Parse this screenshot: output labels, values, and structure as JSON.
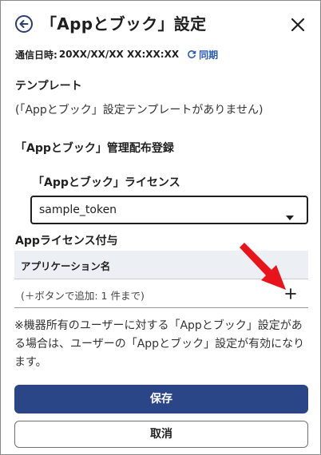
{
  "header": {
    "title": "「Appとブック」設定"
  },
  "sync": {
    "label": "通信日時:",
    "timestamp": "20XX/XX/XX XX:XX:XX",
    "link_label": "同期"
  },
  "template": {
    "heading": "テンプレート",
    "empty_message": "(「Appとブック」設定テンプレートがありません)"
  },
  "management": {
    "heading": "「Appとブック」管理配布登録",
    "license_heading": "「Appとブック」ライセンス",
    "license_select": {
      "selected": "sample_token"
    }
  },
  "app_license": {
    "heading": "Appライセンス付与",
    "table": {
      "column_header": "アプリケーション名",
      "empty_hint": "(＋ボタンで追加: 1 件まで)"
    }
  },
  "note": "※機器所有のユーザーに対する「Appとブック」設定がある場合は、ユーザーの「Appとブック」設定が有効になります。",
  "buttons": {
    "save": "保存",
    "cancel": "取消"
  },
  "colors": {
    "primary": "#2a4686",
    "link": "#2b5bb5",
    "annotation_arrow": "#e8131b",
    "table_header_bg": "#eceff3"
  },
  "icons": {
    "back": "back-circle-arrow-icon",
    "close": "close-icon",
    "sync": "refresh-icon",
    "dropdown": "caret-down-icon",
    "add": "plus-icon",
    "annotation": "red-arrow-icon"
  }
}
